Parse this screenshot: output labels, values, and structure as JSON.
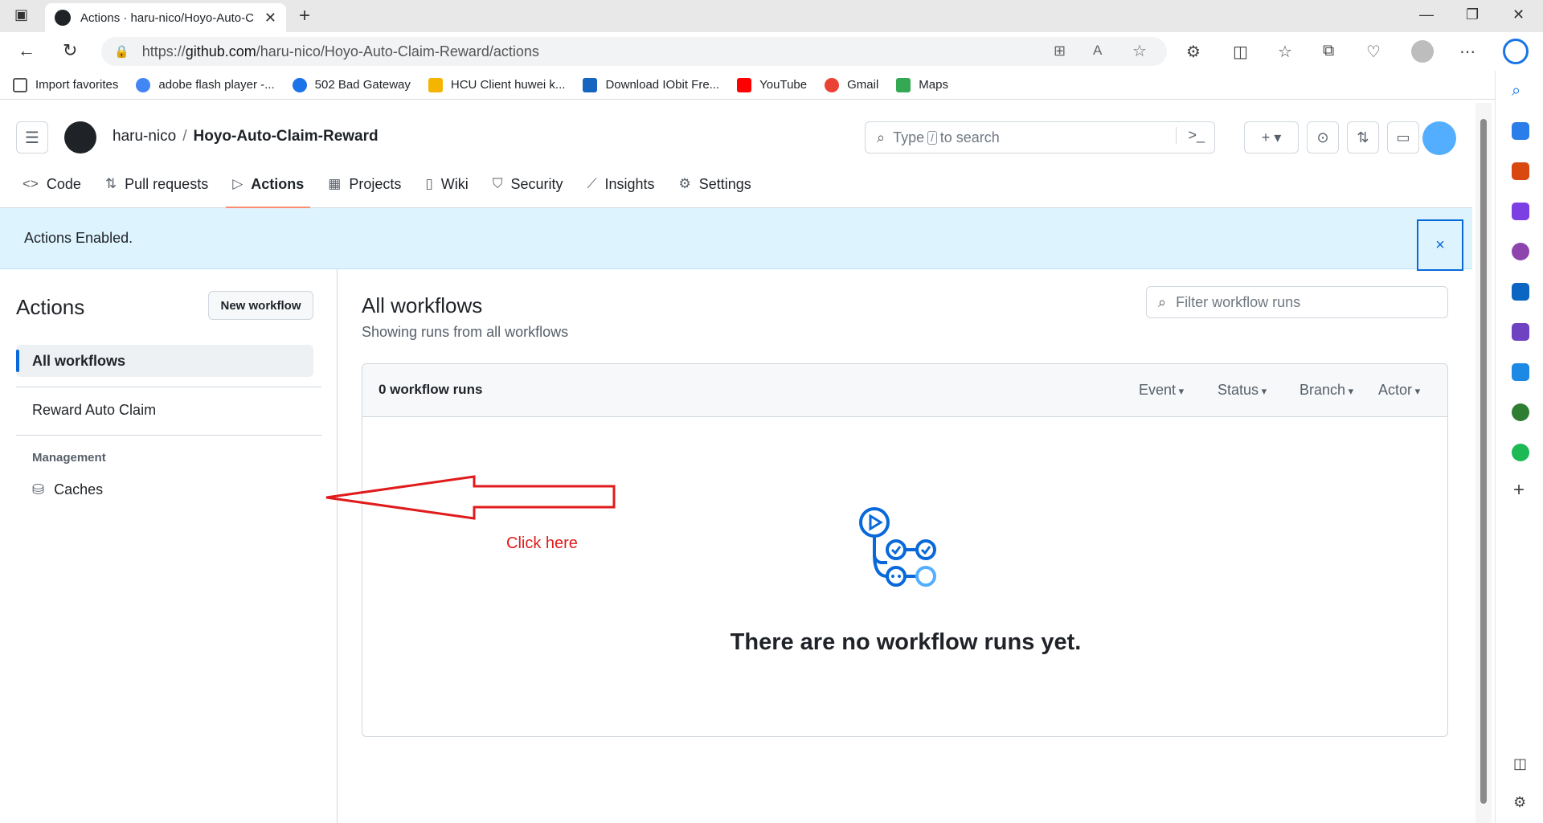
{
  "browser": {
    "tab_title": "Actions · haru-nico/Hoyo-Auto-C",
    "url_scheme": "https://",
    "url_host": "github.com",
    "url_path": "/haru-nico/Hoyo-Auto-Claim-Reward/actions",
    "bookmarks": [
      {
        "label": "Import favorites",
        "color": "#555555"
      },
      {
        "label": "adobe flash player -...",
        "color": "#4285f4"
      },
      {
        "label": "502 Bad Gateway",
        "color": "#1a73e8"
      },
      {
        "label": "HCU Client huwei k...",
        "color": "#f4b400"
      },
      {
        "label": "Download IObit Fre...",
        "color": "#1565c0"
      },
      {
        "label": "YouTube",
        "color": "#ff0000"
      },
      {
        "label": "Gmail",
        "color": "#ea4335"
      },
      {
        "label": "Maps",
        "color": "#34a853"
      }
    ]
  },
  "github": {
    "owner": "haru-nico",
    "separator": "/",
    "repo": "Hoyo-Auto-Claim-Reward",
    "search_prefix": "Type",
    "search_key": "/",
    "search_suffix": "to search",
    "tabs": [
      {
        "label": "Code",
        "icon": "code-icon"
      },
      {
        "label": "Pull requests",
        "icon": "pull-request-icon"
      },
      {
        "label": "Actions",
        "icon": "play-icon"
      },
      {
        "label": "Projects",
        "icon": "table-icon"
      },
      {
        "label": "Wiki",
        "icon": "book-icon"
      },
      {
        "label": "Security",
        "icon": "shield-icon"
      },
      {
        "label": "Insights",
        "icon": "graph-icon"
      },
      {
        "label": "Settings",
        "icon": "gear-icon"
      }
    ],
    "flash": "Actions Enabled.",
    "flash_close": "×"
  },
  "sidebar": {
    "title": "Actions",
    "new_workflow": "New workflow",
    "items": [
      "All workflows",
      "Reward Auto Claim"
    ],
    "group": "Management",
    "caches": "Caches"
  },
  "main": {
    "title": "All workflows",
    "subtitle": "Showing runs from all workflows",
    "filter_placeholder": "Filter workflow runs",
    "runs_count": "0 workflow runs",
    "filters": [
      "Event",
      "Status",
      "Branch",
      "Actor"
    ],
    "empty_message": "There are no workflow runs yet."
  },
  "annotation": {
    "text": "Click here",
    "color": "#e11b1b"
  }
}
